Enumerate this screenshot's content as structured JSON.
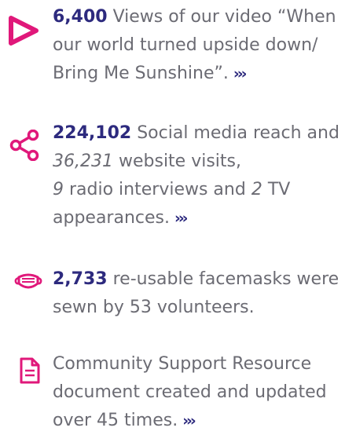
{
  "colors": {
    "accent_pink": "#e0187a",
    "number_navy": "#2d2a7e",
    "body_grey": "#6b6b73"
  },
  "items": [
    {
      "icon": "play-icon",
      "number": "6,400",
      "text": "Views of our video “When our world turned upside down/ Bring Me Sunshine”.",
      "more": "›››"
    },
    {
      "icon": "share-icon",
      "number": "224,102",
      "text_a": "Social media reach and",
      "italic_a": "36,231",
      "text_b": "website visits,",
      "italic_b": "9",
      "text_c": "radio interviews and",
      "italic_c": "2",
      "text_d": "TV appearances.",
      "more": "›››"
    },
    {
      "icon": "facemask-icon",
      "number": "2,733",
      "text": "re-usable facemasks were sewn by 53 volunteers."
    },
    {
      "icon": "document-icon",
      "text": "Community Support Resource document created and updated over 45 times.",
      "more": "›››"
    }
  ]
}
